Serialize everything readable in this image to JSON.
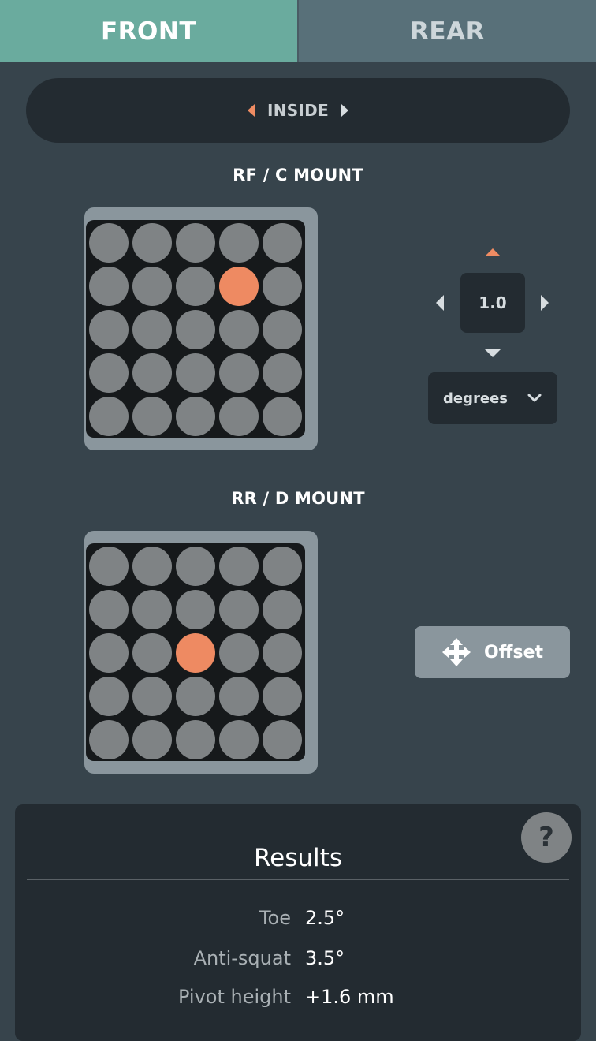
{
  "tabs": {
    "front": "FRONT",
    "rear": "REAR"
  },
  "side_selector": {
    "label": "INSIDE"
  },
  "mounts": [
    {
      "title": "RF / C MOUNT",
      "grid": {
        "rows": 5,
        "cols": 5,
        "selected_row": 1,
        "selected_col": 3
      }
    },
    {
      "title": "RR / D MOUNT",
      "grid": {
        "rows": 5,
        "cols": 5,
        "selected_row": 2,
        "selected_col": 2
      }
    }
  ],
  "adjuster": {
    "value": "1.0",
    "units": "degrees"
  },
  "offset_button": {
    "label": "Offset"
  },
  "results": {
    "title": "Results",
    "help": "?",
    "rows": [
      {
        "label": "Toe",
        "value": "2.5°"
      },
      {
        "label": "Anti-squat",
        "value": "3.5°"
      },
      {
        "label": "Pivot height",
        "value": "+1.6 mm"
      }
    ]
  },
  "colors": {
    "accent": "#ee8a62",
    "tab_active": "#6aab9e",
    "tab_inactive": "#587079",
    "background": "#37444c"
  }
}
